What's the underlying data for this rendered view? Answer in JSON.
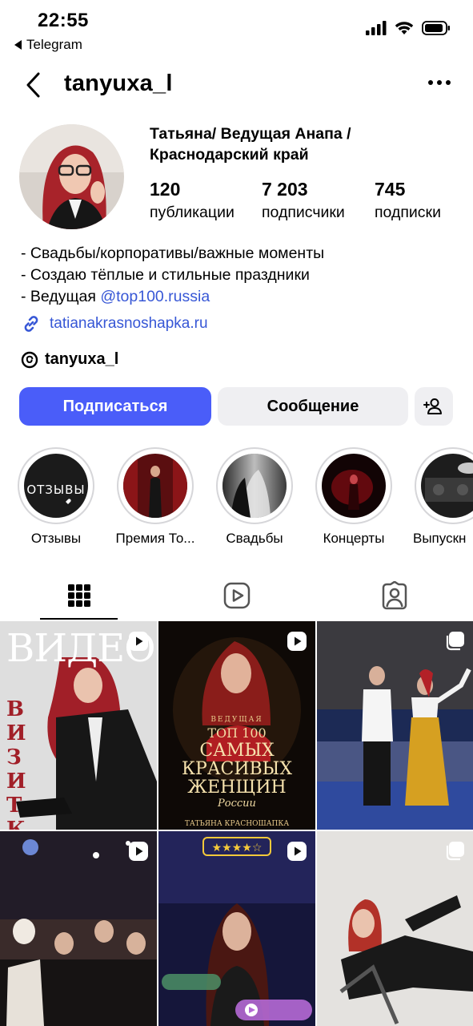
{
  "status_bar": {
    "time": "22:55",
    "back_app": "Telegram"
  },
  "header": {
    "username": "tanyuxa_l",
    "back_icon": "chevron-left-icon",
    "more_icon": "more-horizontal-icon"
  },
  "profile": {
    "full_name": "Татьяна/ Ведущая Анапа / Краснодарский край",
    "stats": [
      {
        "value": "120",
        "label": "публикации"
      },
      {
        "value": "7 203",
        "label": "подписчики"
      },
      {
        "value": "745",
        "label": "подписки"
      }
    ],
    "bio_lines": [
      "- Свадьбы/корпоративы/важные моменты",
      "- Создаю тёплые и стильные праздники"
    ],
    "bio_mention_prefix": "- Ведущая ",
    "bio_mention": "@top100.russia",
    "link": "tatianakrasnoshapka.ru",
    "threads_handle": "tanyuxa_l"
  },
  "actions": {
    "follow": "Подписаться",
    "message": "Сообщение",
    "add_user_icon": "add-user-icon"
  },
  "highlights": [
    {
      "label": "Отзывы",
      "cover_text": "ОТЗЫВЫ"
    },
    {
      "label": "Премия То..."
    },
    {
      "label": "Свадьбы"
    },
    {
      "label": "Концерты"
    },
    {
      "label": "Выпускн"
    }
  ],
  "tabs": [
    {
      "name": "grid",
      "icon": "grid-icon"
    },
    {
      "name": "reels",
      "icon": "reels-icon"
    },
    {
      "name": "tagged",
      "icon": "tagged-icon"
    }
  ],
  "posts": [
    {
      "type": "reel",
      "text_big": "ВИДЕО",
      "text_side": "ВИЗИТКА"
    },
    {
      "type": "reel",
      "text_small": "ВЕДУЩАЯ",
      "text_top": "ТОП 100",
      "text_big": "САМЫХ КРАСИВЫХ ЖЕНЩИН",
      "text_script": "России",
      "text_bottom": "ТАТЬЯНА КРАСНОШАПКА"
    },
    {
      "type": "carousel"
    },
    {
      "type": "reel"
    },
    {
      "type": "reel"
    },
    {
      "type": "carousel"
    }
  ],
  "colors": {
    "accent": "#4a5df9",
    "link": "#3757d6",
    "button_secondary": "#efeff2"
  }
}
